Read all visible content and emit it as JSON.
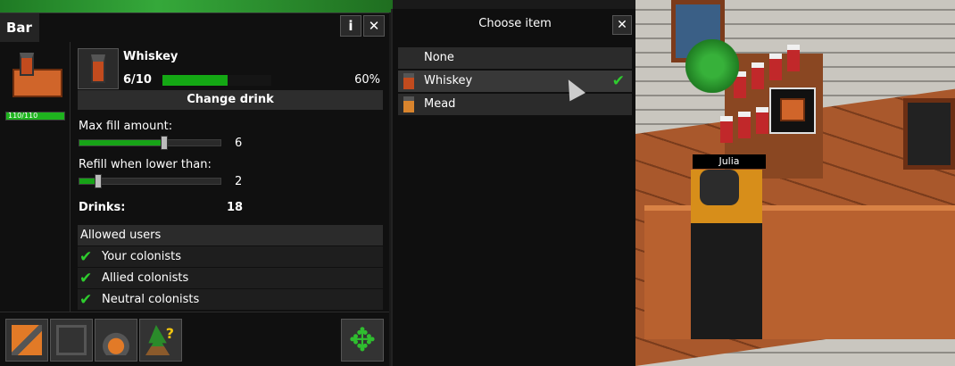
{
  "bar_panel": {
    "title": "Bar",
    "info_label": "i",
    "close_label": "✕",
    "hp": {
      "text": "110/110",
      "fraction": 1.0
    },
    "drink": {
      "name": "Whiskey",
      "count": "6/10",
      "percent_label": "60%",
      "fill_fraction": 0.6
    },
    "change_drink_label": "Change drink",
    "max_fill": {
      "label": "Max fill amount:",
      "value": "6",
      "fraction": 0.6
    },
    "refill": {
      "label": "Refill when lower than:",
      "value": "2",
      "fraction": 0.13
    },
    "drinks": {
      "label": "Drinks:",
      "value": "18"
    },
    "allowed_users": {
      "header": "Allowed users",
      "items": [
        {
          "label": "Your colonists",
          "checked": true
        },
        {
          "label": "Allied colonists",
          "checked": true
        },
        {
          "label": "Neutral colonists",
          "checked": true
        }
      ]
    },
    "toolbar": {
      "tools": [
        "hammer-icon",
        "outline-icon",
        "demolish-icon",
        "tree-help-icon"
      ],
      "help_mark": "?",
      "move_glyph": "✥"
    }
  },
  "choose_item": {
    "title": "Choose item",
    "close_label": "✕",
    "items": [
      {
        "label": "None",
        "icon": "",
        "selected": false
      },
      {
        "label": "Whiskey",
        "icon": "whiskey-bottle-icon",
        "selected": true
      },
      {
        "label": "Mead",
        "icon": "mead-bottle-icon",
        "selected": false
      }
    ],
    "check_glyph": "✔"
  },
  "world": {
    "npc_name": "Julia"
  },
  "colors": {
    "accent_green": "#14a814",
    "check_green": "#2ecc2e",
    "panel_bg": "#101010",
    "orange": "#d0652a"
  }
}
